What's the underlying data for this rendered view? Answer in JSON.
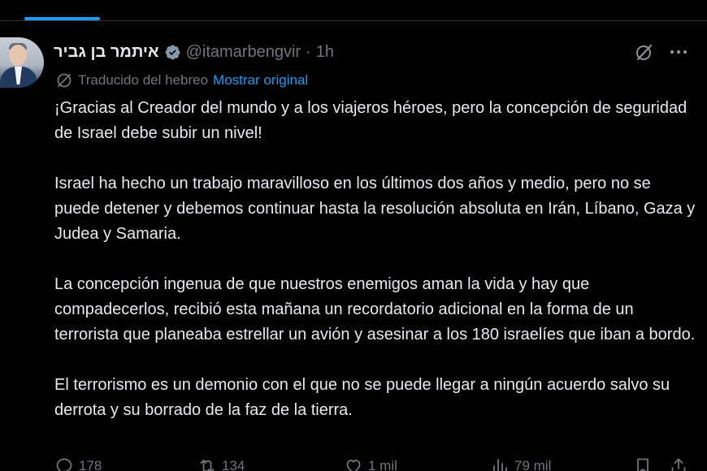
{
  "tweet": {
    "author": {
      "display_name": "איתמר בן גביר",
      "handle": "@itamarbengvir",
      "time_separator": "·",
      "time_ago": "1h",
      "verified_icon": "verified-badge-icon"
    },
    "translation": {
      "label": "Traducido del hebreo",
      "show_original": "Mostrar original"
    },
    "paragraphs": [
      "¡Gracias al Creador del mundo y a los viajeros héroes, pero la concepción de seguridad de Israel debe subir un nivel!",
      "Israel ha hecho un trabajo maravilloso en los últimos dos años y medio, pero no se puede detener y debemos continuar hasta la resolución absoluta en Irán, Líbano, Gaza y Judea y Samaria.",
      "La concepción ingenua de que nuestros enemigos aman la vida y hay que compadecerlos, recibió esta mañana un recordatorio adicional en la forma de un terrorista que planeaba estrellar un avión y asesinar a los 180 israelíes que iban a bordo.",
      "El terrorismo es un demonio con el que no se puede llegar a ningún acuerdo salvo su derrota y su borrado de la faz de la tierra."
    ],
    "actions": {
      "replies": "178",
      "reposts": "134",
      "likes": "1 mil",
      "views": "79 mil"
    }
  },
  "colors": {
    "background": "#000000",
    "text_primary": "#e7e9ea",
    "text_secondary": "#71767b",
    "accent": "#1d9bf0",
    "divider": "#2f3336"
  },
  "icons": [
    "verified-badge-icon",
    "grok-icon",
    "more-icon",
    "translate-icon",
    "reply-icon",
    "repost-icon",
    "like-icon",
    "views-icon",
    "bookmark-icon",
    "share-icon"
  ]
}
